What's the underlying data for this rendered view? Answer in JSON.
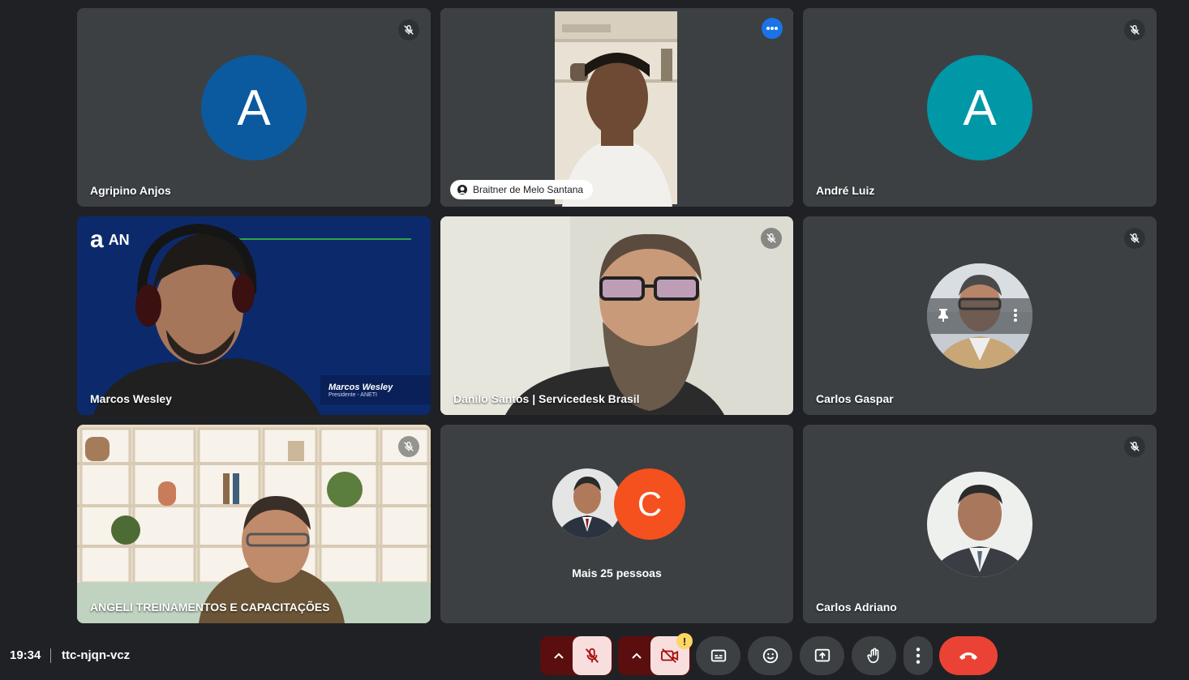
{
  "participants": [
    {
      "name": "Agripino Anjos",
      "initial": "A",
      "color": "#0b5aa0"
    },
    {
      "name": "Braitner de Melo Santana"
    },
    {
      "name": "André Luiz",
      "initial": "A",
      "color": "#0097a7"
    },
    {
      "name": "Marcos Wesley"
    },
    {
      "name": "Danilo Santos | Servicedesk Brasil"
    },
    {
      "name": "Carlos Gaspar"
    },
    {
      "name": "ANGELI TREINAMENTOS E CAPACITAÇÕES"
    },
    {
      "name": "Carlos Adriano"
    }
  ],
  "more": {
    "initial": "C",
    "color": "#f4511e",
    "label": "Mais 25 pessoas"
  },
  "banner": {
    "brand": "a",
    "brand_text": "AN",
    "lower_third_name": "Marcos Wesley",
    "lower_third_role": "Presidente - ANETI"
  },
  "meeting": {
    "time": "19:34",
    "code": "ttc-njqn-vcz"
  },
  "colors": {
    "background": "#202124",
    "tile": "#3c4043",
    "active_border": "#8ab4f8",
    "hangup": "#ea4335"
  },
  "controls": {
    "camera_warning": "!"
  }
}
